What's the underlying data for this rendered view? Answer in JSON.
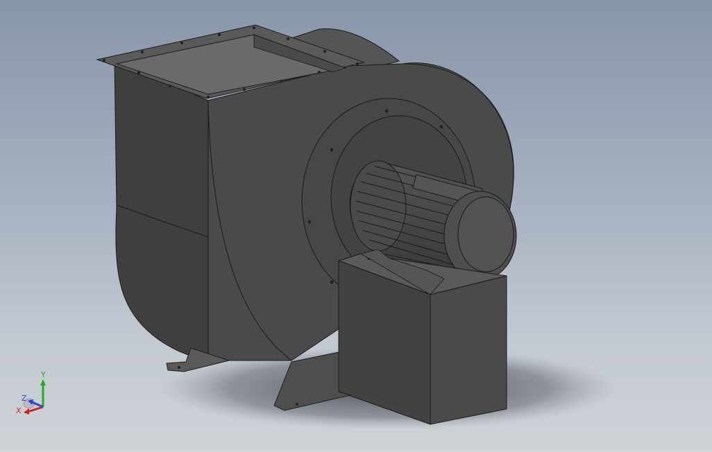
{
  "viewport": {
    "background_top": "#8896aa",
    "background_bottom": "#cfd3d8",
    "model_color": "#4a4a4a",
    "edge_color": "#1a1a1a"
  },
  "triad": {
    "x_label": "X",
    "y_label": "Y",
    "z_label": "Z",
    "x_color": "#cc2222",
    "y_color": "#22aa22",
    "z_color": "#3344cc"
  }
}
